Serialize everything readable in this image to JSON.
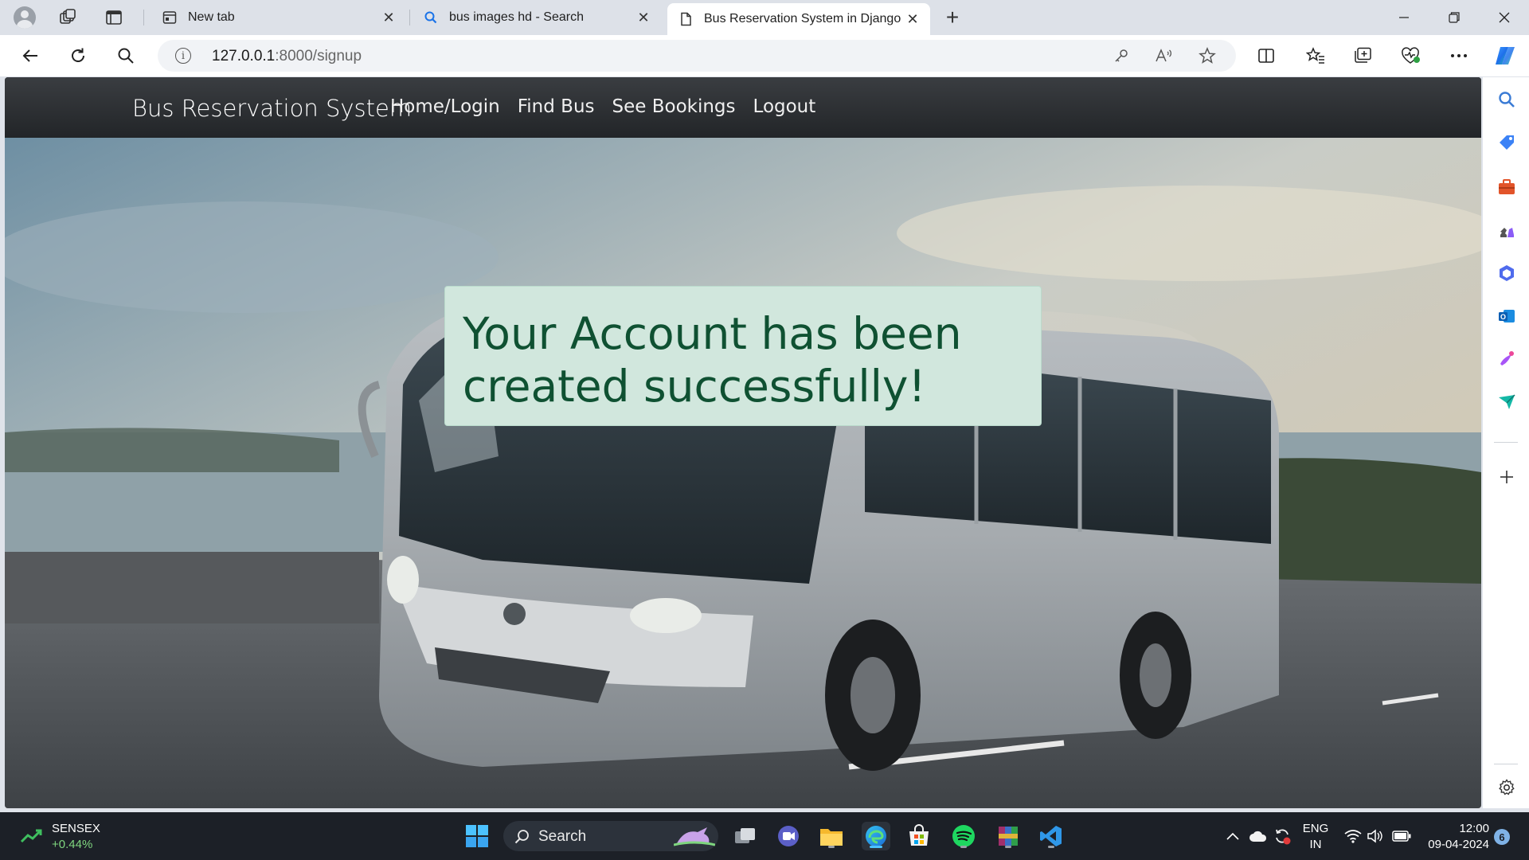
{
  "browser": {
    "tabs": [
      {
        "title": "New tab",
        "icon": "new-tab-icon"
      },
      {
        "title": "bus images hd - Search",
        "icon": "search-icon"
      },
      {
        "title": "Bus Reservation System in Django",
        "icon": "page-icon",
        "active": true
      }
    ],
    "url_host": "127.0.0.1",
    "url_path": ":8000/signup"
  },
  "page": {
    "brand": "Bus Reservation System",
    "nav": [
      "Home/Login",
      "Find Bus",
      "See Bookings",
      "Logout"
    ],
    "alert_line1": "Your Account has been",
    "alert_line2": "created successfully!",
    "colors": {
      "navbar": "#212529",
      "alert_bg": "#d1e7dd",
      "alert_text": "#0f5132"
    }
  },
  "taskbar": {
    "ticker_name": "SENSEX",
    "ticker_change": "+0.44%",
    "search_label": "Search",
    "lang_line1": "ENG",
    "lang_line2": "IN",
    "time": "12:00",
    "date": "09-04-2024",
    "notification_count": "6"
  }
}
